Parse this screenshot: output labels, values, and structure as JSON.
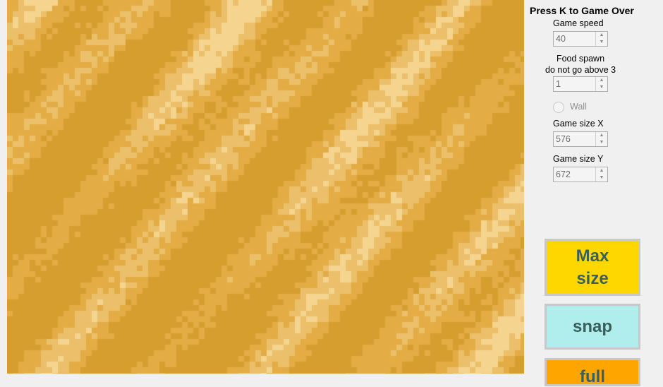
{
  "board": {
    "palette": [
      "#e3ac45",
      "#d59e2f",
      "#ecc06a",
      "#f4d48e"
    ]
  },
  "panel": {
    "hint": "Press K to Game Over",
    "game_speed_label": "Game speed",
    "game_speed_value": "40",
    "food_label_line1": "Food spawn",
    "food_label_line2": "do not go above 3",
    "food_value": "1",
    "wall_label": "Wall",
    "size_x_label": "Game size X",
    "size_x_value": "576",
    "size_y_label": "Game size Y",
    "size_y_value": "672",
    "max_size_line1": "Max",
    "max_size_line2": "size",
    "snap_label": "snap",
    "full_label": "full"
  },
  "colors": {
    "max_button": "#ffd700",
    "snap_button": "#b0eeee",
    "full_button": "#ffa500",
    "button_text": "#3b5f5a"
  }
}
